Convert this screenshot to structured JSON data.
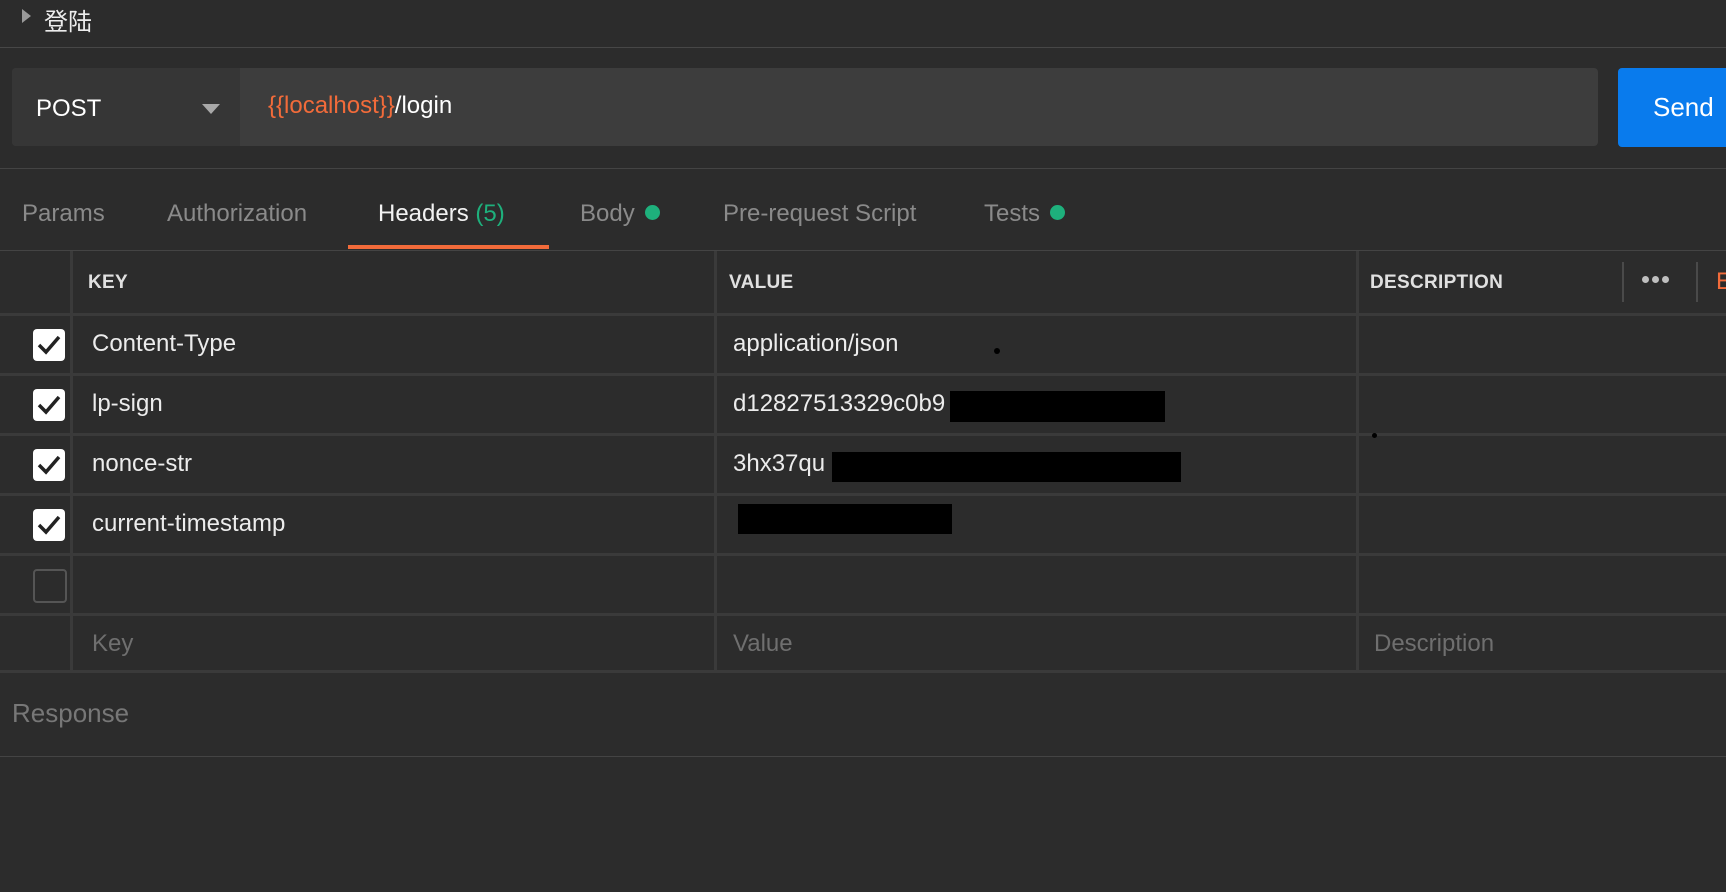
{
  "breadcrumb": {
    "title": "登陆"
  },
  "request": {
    "method": "POST",
    "url_variable": "{{localhost}}",
    "url_path": "/login",
    "send_label": "Send"
  },
  "tabs": [
    {
      "label": "Params"
    },
    {
      "label": "Authorization"
    },
    {
      "label": "Headers",
      "count": "(5)",
      "active": true
    },
    {
      "label": "Body",
      "status_dot": true
    },
    {
      "label": "Pre-request Script"
    },
    {
      "label": "Tests",
      "status_dot": true
    }
  ],
  "headers_table": {
    "columns": [
      "KEY",
      "VALUE",
      "DESCRIPTION"
    ],
    "bulk_edit_label": "E",
    "rows": [
      {
        "checked": true,
        "key": "Content-Type",
        "value": "application/json"
      },
      {
        "checked": true,
        "key": "lp-sign",
        "value": "d12827513329c0b9"
      },
      {
        "checked": true,
        "key": "nonce-str",
        "value": "3hx37qu"
      },
      {
        "checked": true,
        "key": "current-timestamp",
        "value": ""
      },
      {
        "checked": false,
        "key": "",
        "value": ""
      }
    ],
    "placeholders": {
      "key": "Key",
      "value": "Value",
      "description": "Description"
    }
  },
  "response": {
    "label": "Response"
  },
  "colors": {
    "accent": "#f26b3a",
    "send": "#097bed",
    "status": "#1eb07c"
  }
}
